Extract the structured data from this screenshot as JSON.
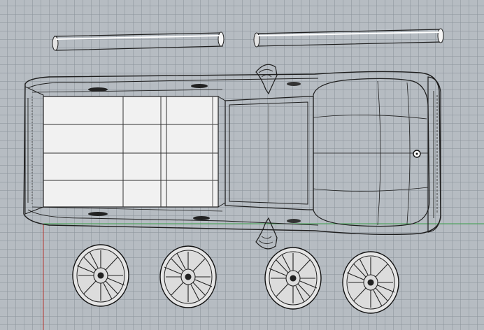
{
  "viewport": {
    "view": "Top",
    "display_mode": "Shaded",
    "background_color": "#b6bcc2",
    "grid_color": "#8c949c",
    "x_axis_color": "#3fa34d",
    "y_axis_color": "#b2352f"
  },
  "scene": {
    "objects": [
      {
        "name": "exhaust-pipe-left",
        "kind": "cylinder"
      },
      {
        "name": "exhaust-pipe-right",
        "kind": "cylinder"
      },
      {
        "name": "vehicle-body",
        "kind": "pickup-truck-top-view"
      },
      {
        "name": "side-mirror-left",
        "kind": "mirror"
      },
      {
        "name": "side-mirror-right",
        "kind": "mirror"
      },
      {
        "name": "wheel-1",
        "kind": "wheel"
      },
      {
        "name": "wheel-2",
        "kind": "wheel"
      },
      {
        "name": "wheel-3",
        "kind": "wheel"
      },
      {
        "name": "wheel-4",
        "kind": "wheel"
      }
    ]
  }
}
